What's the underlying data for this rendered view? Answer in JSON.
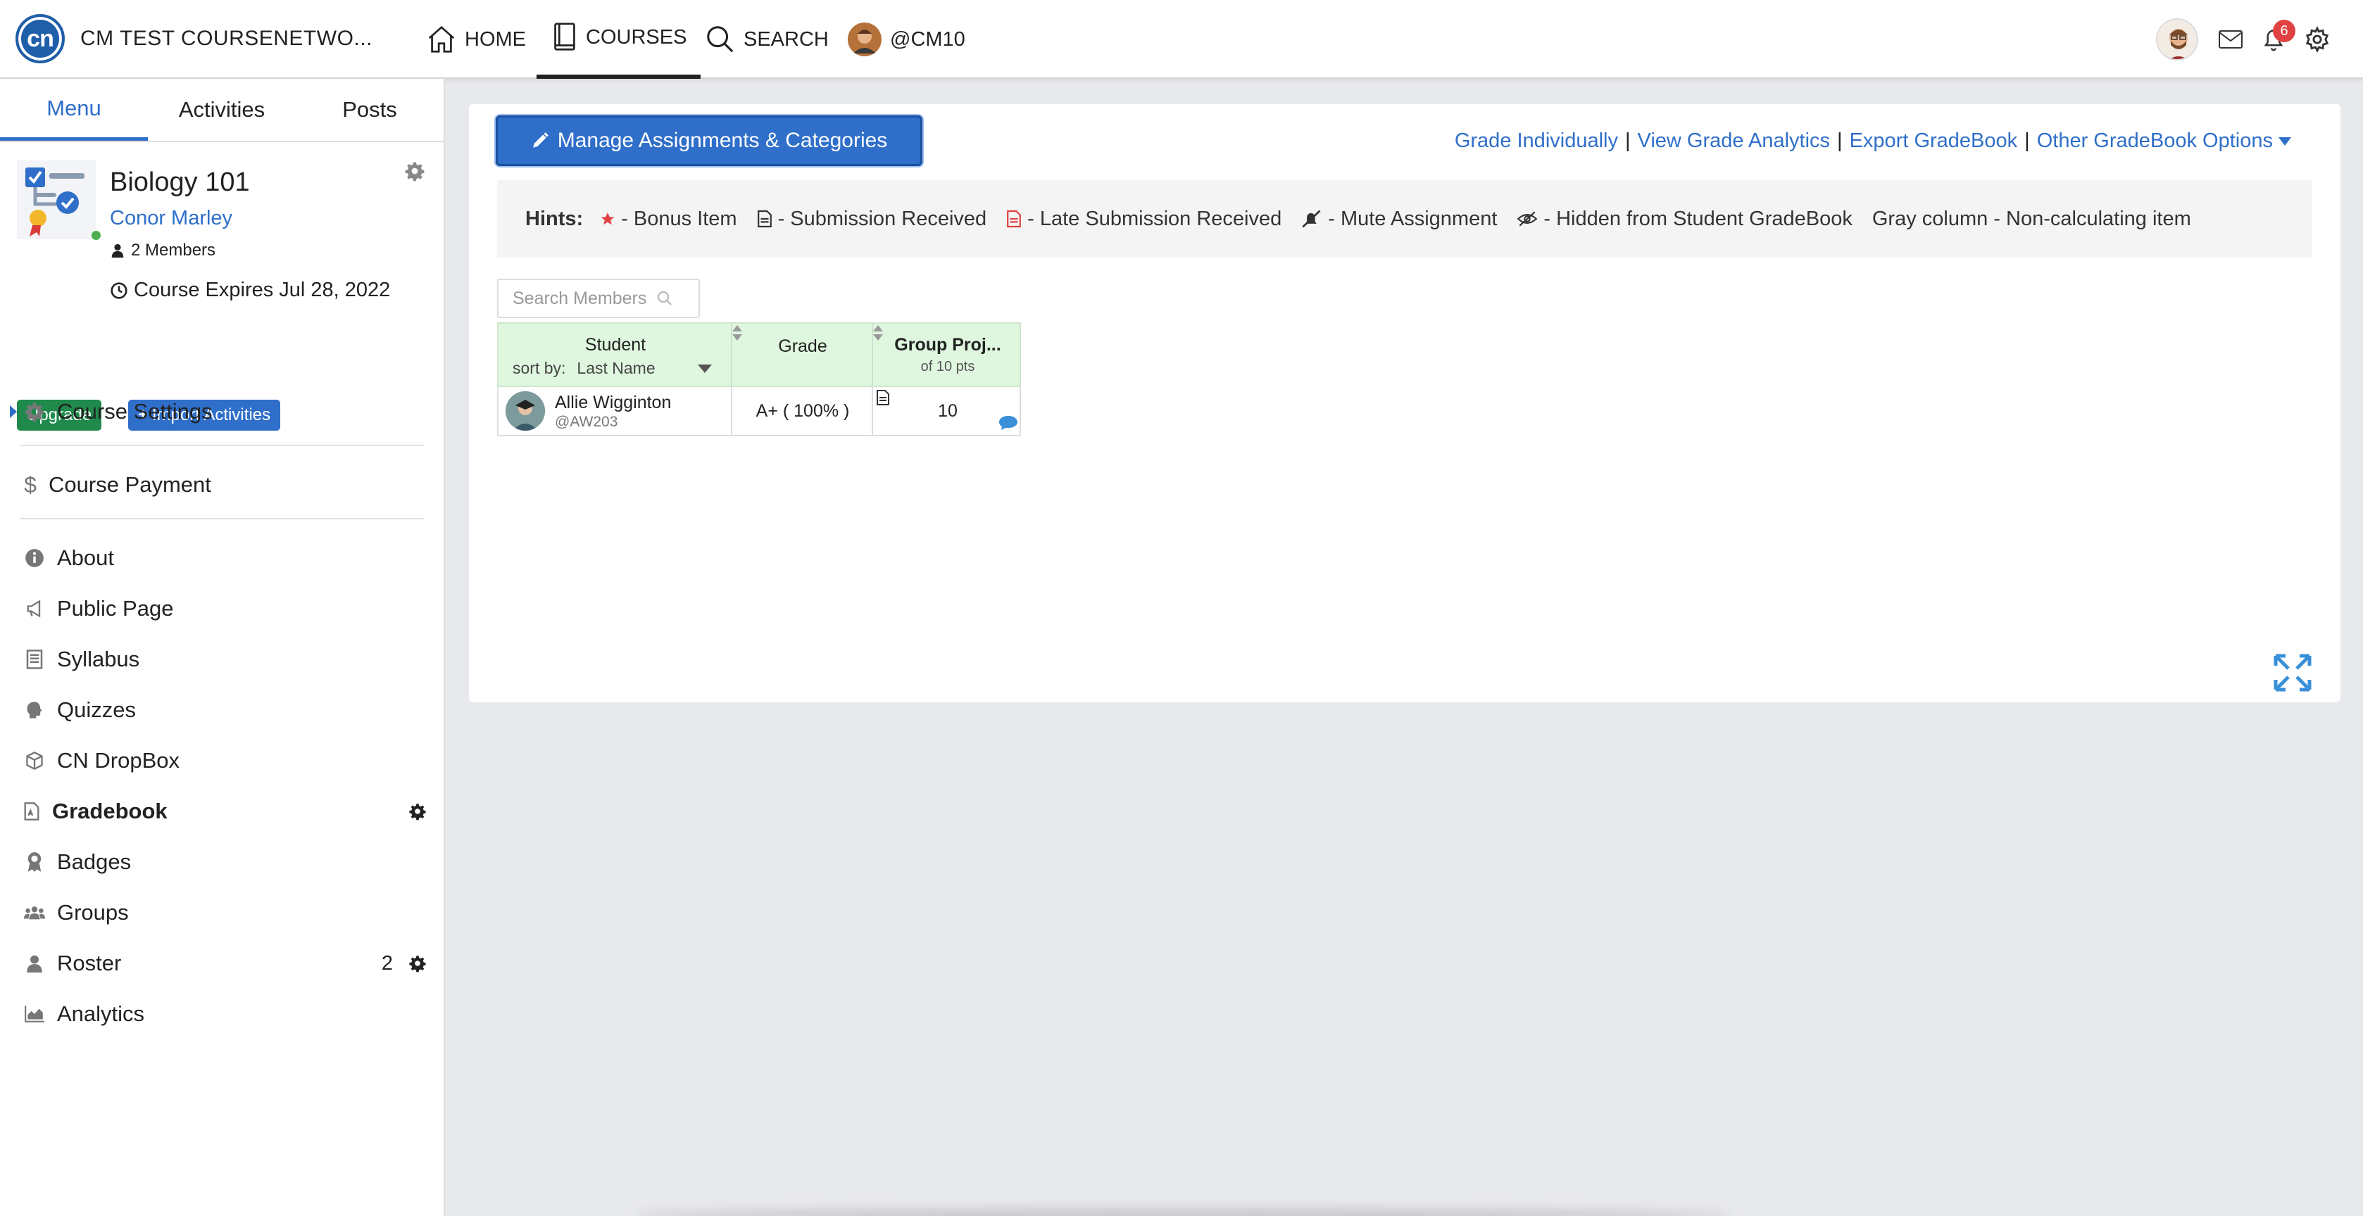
{
  "brand": {
    "logo_text": "cn",
    "name": "CM TEST COURSENETWO..."
  },
  "nav": {
    "home": "HOME",
    "courses": "COURSES",
    "search": "SEARCH",
    "profile": "@CM10"
  },
  "topright": {
    "notification_count": "6"
  },
  "sidebar": {
    "tabs": [
      "Menu",
      "Activities",
      "Posts"
    ],
    "course": {
      "title": "Biology 101",
      "owner": "Conor Marley",
      "members": "2 Members",
      "expires": "Course Expires Jul 28, 2022",
      "upgrade_label": "Upgrade",
      "import_label": "Import Activities"
    },
    "items": [
      {
        "label": "Course Settings",
        "icon": "gear-icon"
      },
      {
        "label": "Course Payment",
        "icon": "dollar-icon"
      },
      {
        "label": "About",
        "icon": "info-icon"
      },
      {
        "label": "Public Page",
        "icon": "megaphone-icon"
      },
      {
        "label": "Syllabus",
        "icon": "document-icon"
      },
      {
        "label": "Quizzes",
        "icon": "head-icon"
      },
      {
        "label": "CN DropBox",
        "icon": "box-icon"
      },
      {
        "label": "Gradebook",
        "icon": "gradebook-icon"
      },
      {
        "label": "Badges",
        "icon": "badge-icon"
      },
      {
        "label": "Groups",
        "icon": "group-icon"
      },
      {
        "label": "Roster",
        "icon": "person-icon",
        "count": "2"
      },
      {
        "label": "Analytics",
        "icon": "chart-icon"
      }
    ]
  },
  "main": {
    "manage_label": "Manage Assignments & Categories",
    "links": [
      "Grade Individually",
      "View Grade Analytics",
      "Export GradeBook",
      "Other GradeBook Options"
    ],
    "hints": {
      "label": "Hints:",
      "items": [
        "- Bonus Item",
        "- Submission Received",
        "- Late Submission Received",
        "- Mute Assignment",
        "- Hidden from Student GradeBook",
        "Gray column - Non-calculating item"
      ]
    },
    "search_placeholder": "Search Members",
    "table": {
      "col_student": "Student",
      "sort_by_label": "sort by:",
      "sort_by_value": "Last Name",
      "col_grade": "Grade",
      "col_assignment": "Group Proj...",
      "col_assignment_sub": "of 10 pts",
      "rows": [
        {
          "name": "Allie Wigginton",
          "handle": "@AW203",
          "grade": "A+ ( 100% )",
          "score": "10"
        }
      ]
    }
  },
  "colors": {
    "accent": "#2f6fc9",
    "upgrade": "#1f8a4c",
    "header_green": "#dff7df",
    "badge": "#e04141"
  }
}
